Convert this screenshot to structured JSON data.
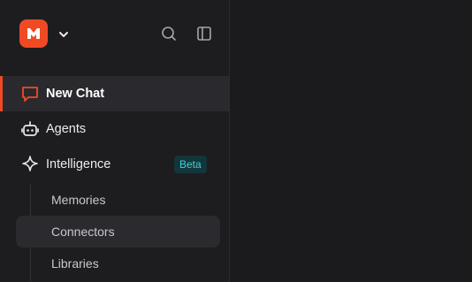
{
  "app": {
    "logo_icon": "m-logo-icon",
    "accent_color": "#ef4a24"
  },
  "header": {
    "dropdown_icon": "chevron-down-icon",
    "search_icon": "search-icon",
    "panel_icon": "sidebar-toggle-icon"
  },
  "nav": {
    "new_chat": {
      "label": "New Chat",
      "icon": "chat-bubble-icon"
    },
    "agents": {
      "label": "Agents",
      "icon": "robot-icon"
    },
    "intelligence": {
      "label": "Intelligence",
      "icon": "sparkle-icon",
      "badge": "Beta",
      "badge_color": "#3fd3dc"
    }
  },
  "intelligence_children": [
    {
      "label": "Memories"
    },
    {
      "label": "Connectors"
    },
    {
      "label": "Libraries"
    }
  ]
}
